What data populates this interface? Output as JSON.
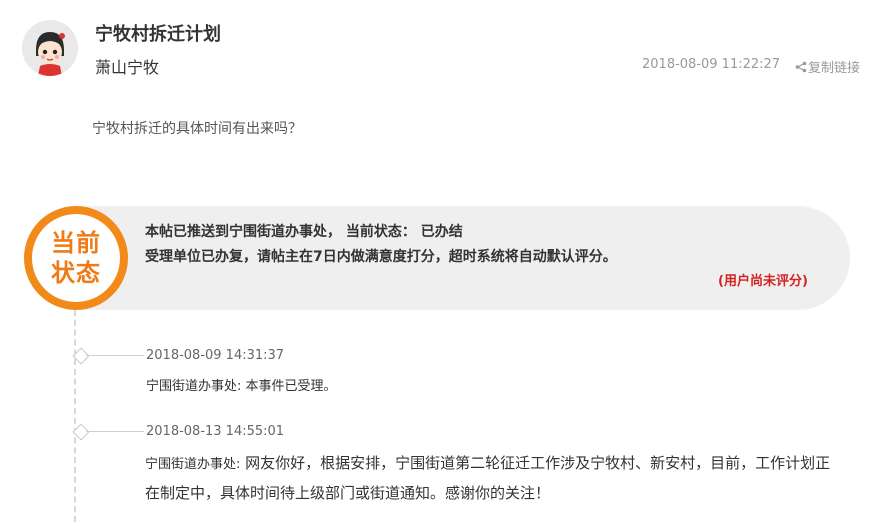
{
  "post": {
    "title": "宁牧村拆迁计划",
    "author": "萧山宁牧",
    "datetime": "2018-08-09 11:22:27",
    "copy_link_label": "复制链接",
    "question": "宁牧村拆迁的具体时间有出来吗？"
  },
  "status": {
    "badge_line1": "当前",
    "badge_line2": "状态",
    "line1": "本帖已推送到宁围街道办事处， 当前状态： 已办结",
    "line2": "受理单位已办复，请帖主在7日内做满意度打分，超时系统将自动默认评分。",
    "rating": "(用户尚未评分)",
    "badge_color": "#f28a1a"
  },
  "timeline": [
    {
      "date": "2018-08-09 14:31:37",
      "dept": "宁围街道办事处:",
      "text": "本事件已受理。"
    },
    {
      "date": "2018-08-13 14:55:01",
      "dept": "宁围街道办事处:",
      "text": "网友你好，根据安排，宁围街道第二轮征迁工作涉及宁牧村、新安村，目前，工作计划正在制定中，具体时间待上级部门或街道通知。感谢你的关注！"
    }
  ]
}
